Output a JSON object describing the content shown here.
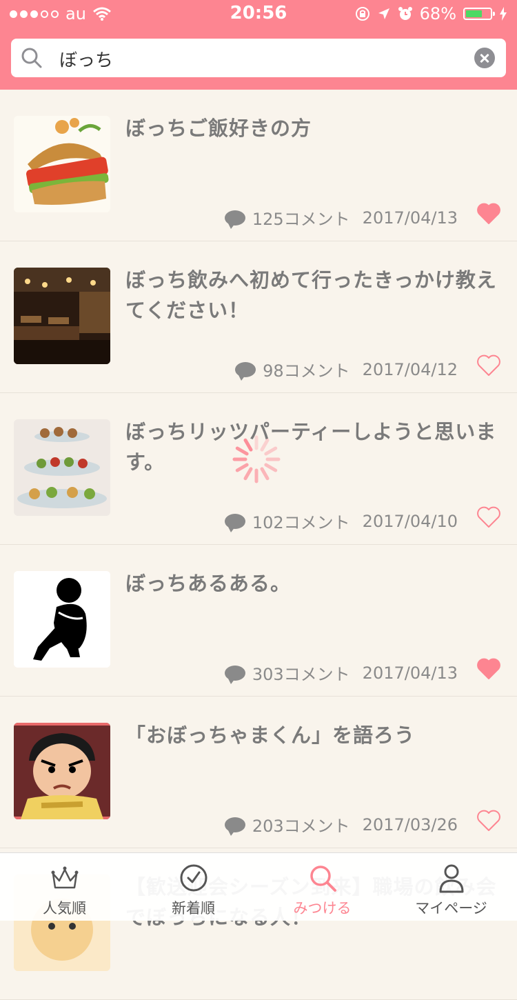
{
  "status_bar": {
    "carrier": "au",
    "time": "20:56",
    "battery_percent": "68%",
    "battery_level": 0.68,
    "battery_color": "#4cd964"
  },
  "search": {
    "query": "ぼっち",
    "icon": "search-icon",
    "clear_icon": "clear-icon"
  },
  "theme": {
    "accent": "#fd8591",
    "background": "#f9f4ec",
    "text": "#7a7a7a"
  },
  "posts": [
    {
      "title": "ぼっちご飯好きの方",
      "comments": "125コメント",
      "date": "2017/04/13",
      "liked": true,
      "thumbnail": "burger-photo"
    },
    {
      "title": "ぼっち飲みへ初めて行ったきっかけ教えてください！",
      "comments": "98コメント",
      "date": "2017/04/12",
      "liked": false,
      "thumbnail": "bar-photo"
    },
    {
      "title": "ぼっちリッツパーティーしようと思います。",
      "comments": "102コメント",
      "date": "2017/04/10",
      "liked": false,
      "thumbnail": "appetizer-tray-photo"
    },
    {
      "title": "ぼっちあるある。",
      "comments": "303コメント",
      "date": "2017/04/13",
      "liked": true,
      "thumbnail": "sitting-person-icon"
    },
    {
      "title": "「おぼっちゃまくん」を語ろう",
      "comments": "203コメント",
      "date": "2017/03/26",
      "liked": false,
      "thumbnail": "cartoon-boy-image"
    }
  ],
  "partial_post": {
    "title": "【歓送迎会シーズン到来】職場の飲み会でぼっちになる人！"
  },
  "loading": true,
  "tabs": [
    {
      "label": "人気順",
      "icon": "crown-icon",
      "active": false
    },
    {
      "label": "新着順",
      "icon": "clock-icon",
      "active": false
    },
    {
      "label": "みつける",
      "icon": "search-icon",
      "active": true
    },
    {
      "label": "マイページ",
      "icon": "person-icon",
      "active": false
    }
  ]
}
